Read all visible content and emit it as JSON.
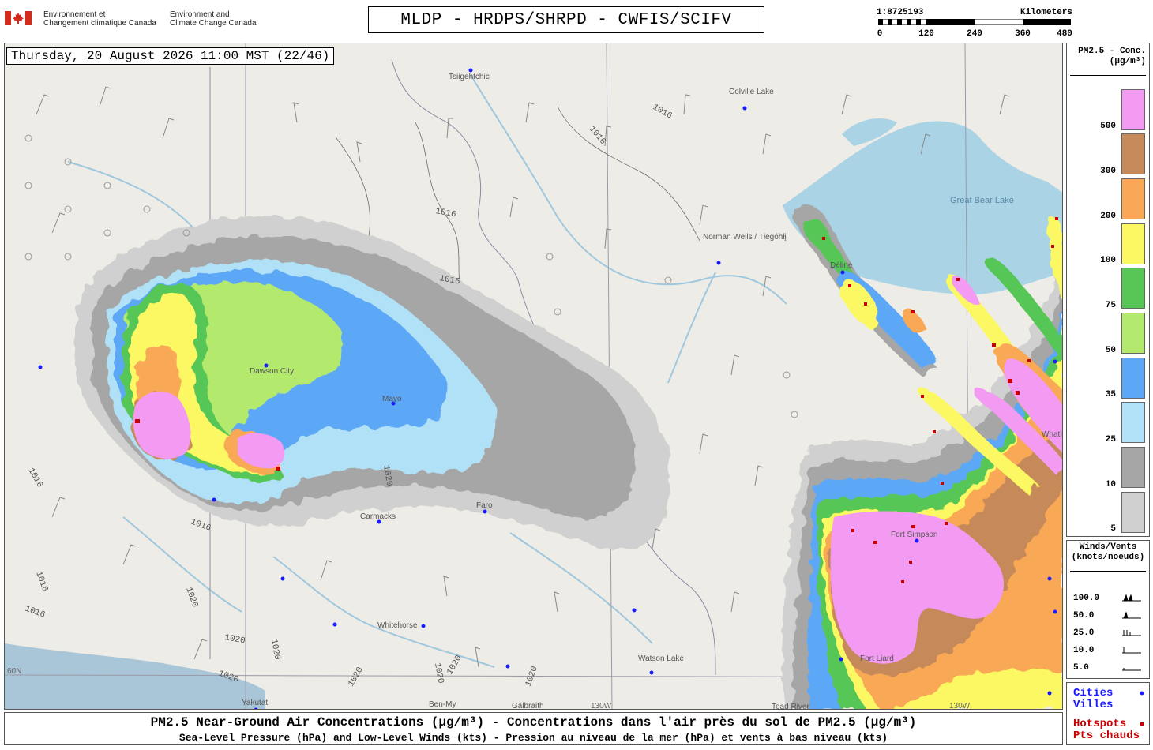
{
  "header": {
    "agency_fr_line1": "Environnement et",
    "agency_fr_line2": "Changement climatique Canada",
    "agency_en_line1": "Environment and",
    "agency_en_line2": "Climate Change Canada",
    "title": "MLDP - HRDPS/SHRPD - CWFIS/SCIFV",
    "scale": {
      "ratio": "1:8725193",
      "units": "Kilometers",
      "ticks": [
        "0",
        "120",
        "240",
        "360",
        "480"
      ]
    }
  },
  "map": {
    "timestamp": "Thursday, 20 August 2026 11:00 MST (22/46)",
    "places": [
      {
        "name": "Tsiigehtchic"
      },
      {
        "name": "Colville Lake"
      },
      {
        "name": "Norman Wells / Tłegóhłį"
      },
      {
        "name": "Great Bear Lake"
      },
      {
        "name": "Déline"
      },
      {
        "name": "Dawson City"
      },
      {
        "name": "Mayo"
      },
      {
        "name": "Faro"
      },
      {
        "name": "Carmacks"
      },
      {
        "name": "Whitehorse"
      },
      {
        "name": "Watson Lake"
      },
      {
        "name": "Yakutat"
      },
      {
        "name": "Ben-My"
      },
      {
        "name": "Galbraith"
      },
      {
        "name": "Toad River"
      },
      {
        "name": "Whatì"
      },
      {
        "name": "Fort Simpson"
      },
      {
        "name": "Fort Liard"
      }
    ],
    "isobars": [
      "1016",
      "1016",
      "1016",
      "1016",
      "1016",
      "1016",
      "1016",
      "1016",
      "1020",
      "1020",
      "1020",
      "1020",
      "1020",
      "1020",
      "1020",
      "1020",
      "1020"
    ],
    "gridlines": [
      "60N",
      "130W",
      "130W"
    ]
  },
  "legend": {
    "title_line1": "PM2.5 - Conc.",
    "title_line2": "(µg/m³)",
    "items": [
      {
        "label": "500",
        "color": "#f39af2"
      },
      {
        "label": "300",
        "color": "#c68a5a"
      },
      {
        "label": "200",
        "color": "#f9a857"
      },
      {
        "label": "100",
        "color": "#fbf864"
      },
      {
        "label": "75",
        "color": "#57c657"
      },
      {
        "label": "50",
        "color": "#b3ea6e"
      },
      {
        "label": "35",
        "color": "#5ca8f6"
      },
      {
        "label": "25",
        "color": "#b1e1f6"
      },
      {
        "label": "10",
        "color": "#a6a6a6"
      },
      {
        "label": "5",
        "color": "#d0d0d0"
      }
    ]
  },
  "wind_legend": {
    "title_line1": "Winds/Vents",
    "title_line2": "(knots/noeuds)",
    "items": [
      "100.0",
      "50.0",
      "25.0",
      "10.0",
      "5.0"
    ]
  },
  "cities_legend": {
    "cities_en": "Cities",
    "cities_fr": "Villes",
    "cities_color": "#1a1aff",
    "hotspots_en": "Hotspots",
    "hotspots_fr": "Pts chauds",
    "hotspots_color": "#cc0000"
  },
  "footer": {
    "line1": "PM2.5 Near-Ground Air Concentrations (µg/m³) - Concentrations dans l'air près du sol de PM2.5 (µg/m³)",
    "line2": "Sea-Level Pressure (hPa) and Low-Level Winds (kts) - Pression au niveau de la mer (hPa) et vents à bas niveau (kts)"
  }
}
